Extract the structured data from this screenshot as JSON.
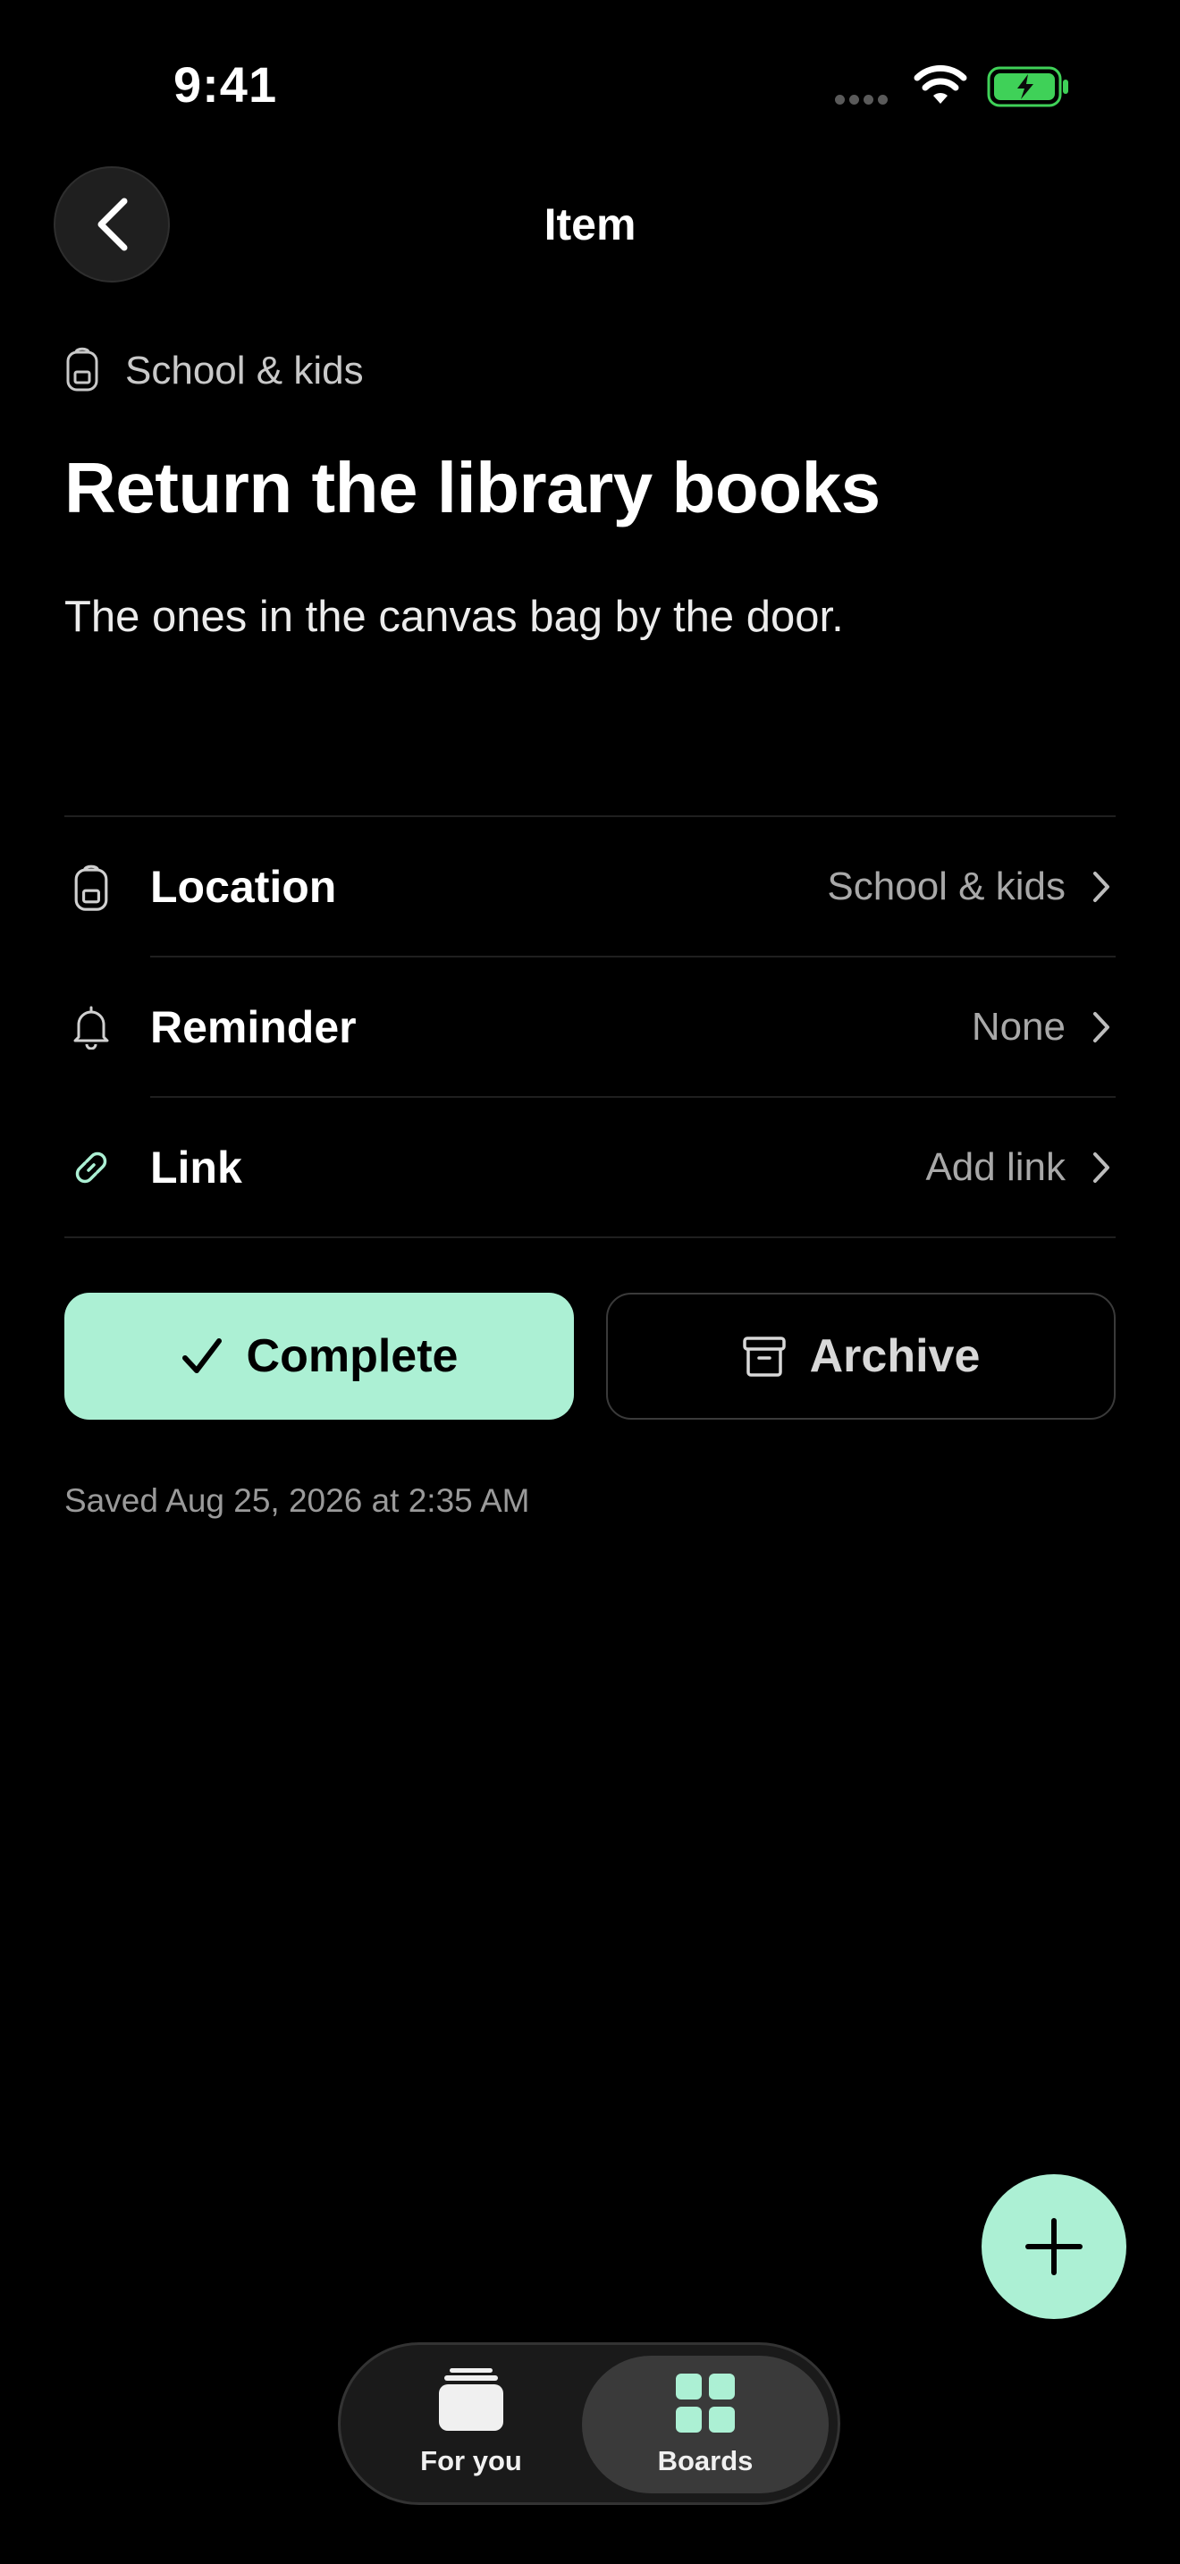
{
  "status_bar": {
    "time": "9:41"
  },
  "nav": {
    "title": "Item"
  },
  "item": {
    "category": "School & kids",
    "title": "Return the library books",
    "description": "The ones in the canvas bag by the door."
  },
  "rows": [
    {
      "label": "Location",
      "value": "School & kids",
      "icon": "backpack-icon"
    },
    {
      "label": "Reminder",
      "value": "None",
      "icon": "bell-icon"
    },
    {
      "label": "Link",
      "value": "Add link",
      "icon": "link-icon"
    }
  ],
  "actions": {
    "complete": "Complete",
    "archive": "Archive"
  },
  "saved_text": "Saved Aug 25, 2026 at 2:35 AM",
  "tabs": [
    {
      "label": "For you",
      "icon": "stack-icon"
    },
    {
      "label": "Boards",
      "icon": "grid-icon",
      "selected": true
    }
  ],
  "colors": {
    "accent": "#acf0d4",
    "background": "#000000",
    "battery": "#3fd158"
  }
}
